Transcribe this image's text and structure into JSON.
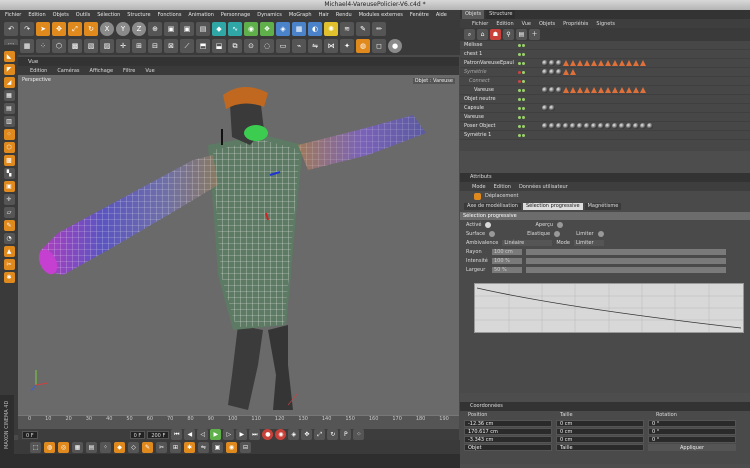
{
  "window": {
    "title": "Michael4-VareusePolicier-V6.c4d *"
  },
  "menubar": [
    "Fichier",
    "Edition",
    "Objets",
    "Outils",
    "Sélection",
    "Structure",
    "Fonctions",
    "Animation",
    "Personnage",
    "Dynamics",
    "MoGraph",
    "Hair",
    "Rendu",
    "Modules externes",
    "Fenêtre",
    "Aide"
  ],
  "viewport": {
    "panel_title": "Vue",
    "menu": [
      "Edition",
      "Caméras",
      "Affichage",
      "Filtre",
      "Vue"
    ],
    "label": "Perspective",
    "right_label": "Objet : Vareuse"
  },
  "timeline": {
    "ticks": [
      "0",
      "10",
      "20",
      "30",
      "40",
      "50",
      "60",
      "70",
      "80",
      "90",
      "100",
      "110",
      "120",
      "130",
      "140",
      "150",
      "160",
      "170",
      "180",
      "190"
    ],
    "current": "0 F",
    "start": "0 F",
    "end": "200 F"
  },
  "object_manager": {
    "tabs": [
      "Objets",
      "Structure"
    ],
    "menu": [
      "Fichier",
      "Edition",
      "Vue",
      "Objets",
      "Propriétés",
      "Signets"
    ],
    "rows": [
      {
        "name": "Mélisse",
        "indent": 0
      },
      {
        "name": "chest 1",
        "indent": 0
      },
      {
        "name": "PatronVareuseEpaul",
        "indent": 0
      },
      {
        "name": "Symétrie",
        "indent": 0,
        "dim": true
      },
      {
        "name": "Connect",
        "indent": 1,
        "dim": true
      },
      {
        "name": "Vareuse",
        "indent": 2
      },
      {
        "name": "Objet neutre",
        "indent": 0
      },
      {
        "name": "Capsule",
        "indent": 0
      },
      {
        "name": "Vareuse",
        "indent": 0
      },
      {
        "name": "Poser Object",
        "indent": 0
      },
      {
        "name": "Symétrie 1",
        "indent": 0
      }
    ]
  },
  "attributes": {
    "title": "Attributs",
    "menu": [
      "Mode",
      "Edition",
      "Données utilisateur"
    ],
    "object": "Déplacement",
    "tabs": [
      "Axe de modélisation",
      "Sélection progressive",
      "Magnétisme"
    ],
    "active_tab": "Sélection progressive",
    "section": "Sélection progressive",
    "options": {
      "active": "Activé",
      "aperçu": "Aperçu",
      "surface": "Surface",
      "elastique": "Elastique",
      "limiter": "Limiter",
      "ambivalence_label": "Ambivalence",
      "ambivalence_value": "Linéaire",
      "mode_label": "Mode",
      "mode_value": "Limiter",
      "rayon_label": "Rayon",
      "rayon_value": "100 cm",
      "intensite_label": "Intensité",
      "intensite_value": "100 %",
      "largeur_label": "Largeur",
      "largeur_value": "50 %"
    }
  },
  "coordinates": {
    "title": "Coordonnées",
    "headers": [
      "Position",
      "Taille",
      "Rotation"
    ],
    "rows": [
      {
        "pos": "-12.36 cm",
        "size": "0 cm",
        "rot": "0 °"
      },
      {
        "pos": "170.617 cm",
        "size": "0 cm",
        "rot": "0 °"
      },
      {
        "pos": "-3.343 cm",
        "size": "0 cm",
        "rot": "0 °"
      }
    ],
    "mode": "Objet",
    "size_mode": "Taille",
    "apply": "Appliquer"
  },
  "logo": "MAXON CINEMA 4D"
}
